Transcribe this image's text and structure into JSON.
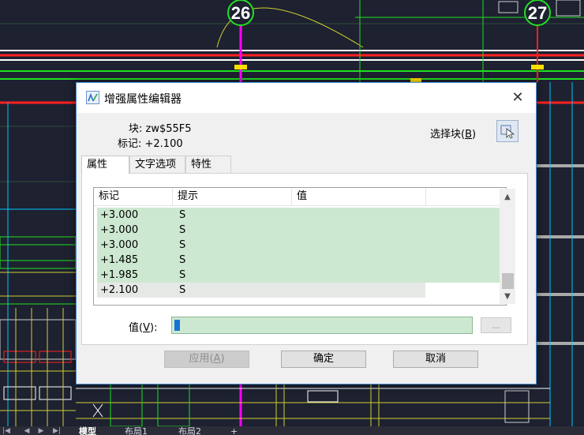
{
  "cad": {
    "axis_labels": [
      "26",
      "27"
    ],
    "colors": {
      "background": "#1d2130",
      "axis": "#ff00ff",
      "green": "#22e022",
      "red": "#ff2020",
      "white": "#ffffff",
      "cyan": "#00c8ff",
      "yellow": "#ffe000"
    }
  },
  "layout_tabs": [
    "模型",
    "布局1",
    "布局2",
    "+"
  ],
  "dialog": {
    "title": "增强属性编辑器",
    "close_icon": "close-icon",
    "block_label": "块: zw$55F5",
    "tag_label": "标记: +2.100",
    "select_block_label": "选择块",
    "select_block_hotkey": "B",
    "tabs": [
      "属性",
      "文字选项",
      "特性"
    ],
    "columns": [
      "标记",
      "提示",
      "值"
    ],
    "rows": [
      {
        "tag": "+3.000",
        "prompt": "S",
        "value": ""
      },
      {
        "tag": "+3.000",
        "prompt": "S",
        "value": ""
      },
      {
        "tag": "+3.000",
        "prompt": "S",
        "value": ""
      },
      {
        "tag": "+1.485",
        "prompt": "S",
        "value": ""
      },
      {
        "tag": "+1.985",
        "prompt": "S",
        "value": ""
      },
      {
        "tag": "+2.100",
        "prompt": "S",
        "value": ""
      }
    ],
    "value_label": "值",
    "value_hotkey": "V",
    "value_input": "",
    "ellipsis_label": "...",
    "apply_label": "应用",
    "apply_hotkey": "A",
    "ok_label": "确定",
    "cancel_label": "取消",
    "colors": {
      "accent": "#4a90d9",
      "list_row": "#cde8d1",
      "selected_row": "#e6e8e6"
    }
  }
}
